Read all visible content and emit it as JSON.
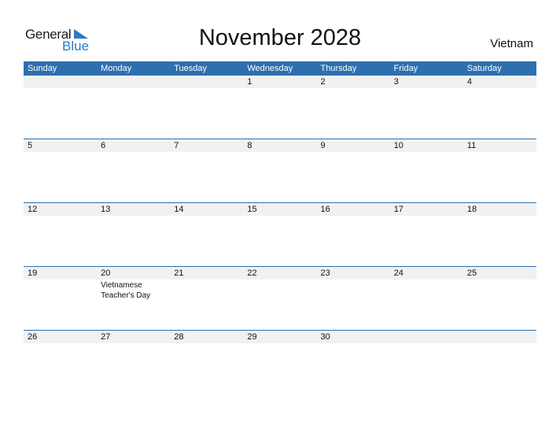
{
  "brand": {
    "line1": "General",
    "line2": "Blue"
  },
  "title": "November 2028",
  "country": "Vietnam",
  "colors": {
    "accent": "#2e6fb0",
    "strip": "#f1f1f1"
  },
  "weekdays": [
    "Sunday",
    "Monday",
    "Tuesday",
    "Wednesday",
    "Thursday",
    "Friday",
    "Saturday"
  ],
  "weeks": [
    {
      "days": [
        "",
        "",
        "",
        "1",
        "2",
        "3",
        "4"
      ],
      "events": [
        "",
        "",
        "",
        "",
        "",
        "",
        ""
      ]
    },
    {
      "days": [
        "5",
        "6",
        "7",
        "8",
        "9",
        "10",
        "11"
      ],
      "events": [
        "",
        "",
        "",
        "",
        "",
        "",
        ""
      ]
    },
    {
      "days": [
        "12",
        "13",
        "14",
        "15",
        "16",
        "17",
        "18"
      ],
      "events": [
        "",
        "",
        "",
        "",
        "",
        "",
        ""
      ]
    },
    {
      "days": [
        "19",
        "20",
        "21",
        "22",
        "23",
        "24",
        "25"
      ],
      "events": [
        "",
        "Vietnamese Teacher's Day",
        "",
        "",
        "",
        "",
        ""
      ]
    },
    {
      "days": [
        "26",
        "27",
        "28",
        "29",
        "30",
        "",
        ""
      ],
      "events": [
        "",
        "",
        "",
        "",
        "",
        "",
        ""
      ]
    }
  ]
}
